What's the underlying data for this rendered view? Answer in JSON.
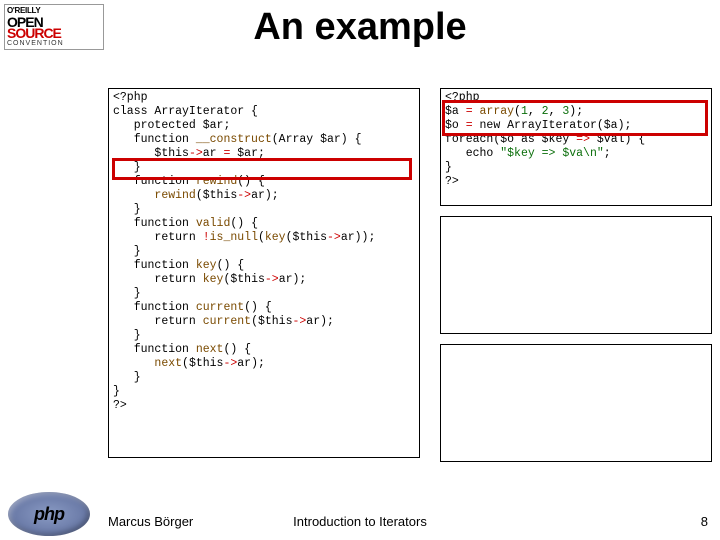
{
  "logo": {
    "top": "O'REILLY",
    "open": "OPEN",
    "source": "SOURCE",
    "conv": "CONVENTION"
  },
  "title": "An example",
  "code_left_html": "&lt;?php\n<span class='kw'>class</span> ArrayIterator {\n   <span class='kw'>protected</span> <span class='var'>$ar</span>;\n   <span class='kw'>function</span> <span class='fn'>__construct</span>(Array <span class='var'>$ar</span>) {\n      <span class='var'>$this</span><span class='op'>-&gt;</span><span class='var'>ar</span> <span class='op'>=</span> <span class='var'>$ar</span>;\n   }\n   <span class='kw'>function</span> <span class='fn'>rewind</span>() {\n      <span class='fn'>rewind</span>(<span class='var'>$this</span><span class='op'>-&gt;</span><span class='var'>ar</span>);\n   }\n   <span class='kw'>function</span> <span class='fn'>valid</span>() {\n      <span class='kw'>return</span> <span class='op'>!</span><span class='fn'>is_null</span>(<span class='fn'>key</span>(<span class='var'>$this</span><span class='op'>-&gt;</span><span class='var'>ar</span>));\n   }\n   <span class='kw'>function</span> <span class='fn'>key</span>() {\n      <span class='kw'>return</span> <span class='fn'>key</span>(<span class='var'>$this</span><span class='op'>-&gt;</span><span class='var'>ar</span>);\n   }\n   <span class='kw'>function</span> <span class='fn'>current</span>() {\n      <span class='kw'>return</span> <span class='fn'>current</span>(<span class='var'>$this</span><span class='op'>-&gt;</span><span class='var'>ar</span>);\n   }\n   <span class='kw'>function</span> <span class='fn'>next</span>() {\n      <span class='fn'>next</span>(<span class='var'>$this</span><span class='op'>-&gt;</span><span class='var'>ar</span>);\n   }\n}\n?&gt;",
  "code_right_html": "&lt;?php\n<span class='var'>$a</span> <span class='op'>=</span> <span class='fn'>array</span>(<span class='num'>1</span>, <span class='num'>2</span>, <span class='num'>3</span>);\n<span class='var'>$o</span> <span class='op'>=</span> <span class='kw'>new</span> ArrayIterator(<span class='var'>$a</span>);\n<span class='kw'>foreach</span>(<span class='var'>$o</span> <span class='kw'>as</span> <span class='var'>$key</span> <span class='op'>=&gt;</span> <span class='var'>$val</span>) {\n   <span class='kw'>echo</span> <span class='str'>\"$key =&gt; $va\\n\"</span>;\n}\n?&gt;",
  "footer": {
    "author": "Marcus Börger",
    "mid": "Introduction to Iterators",
    "page": "8"
  },
  "php_logo_text": "php"
}
